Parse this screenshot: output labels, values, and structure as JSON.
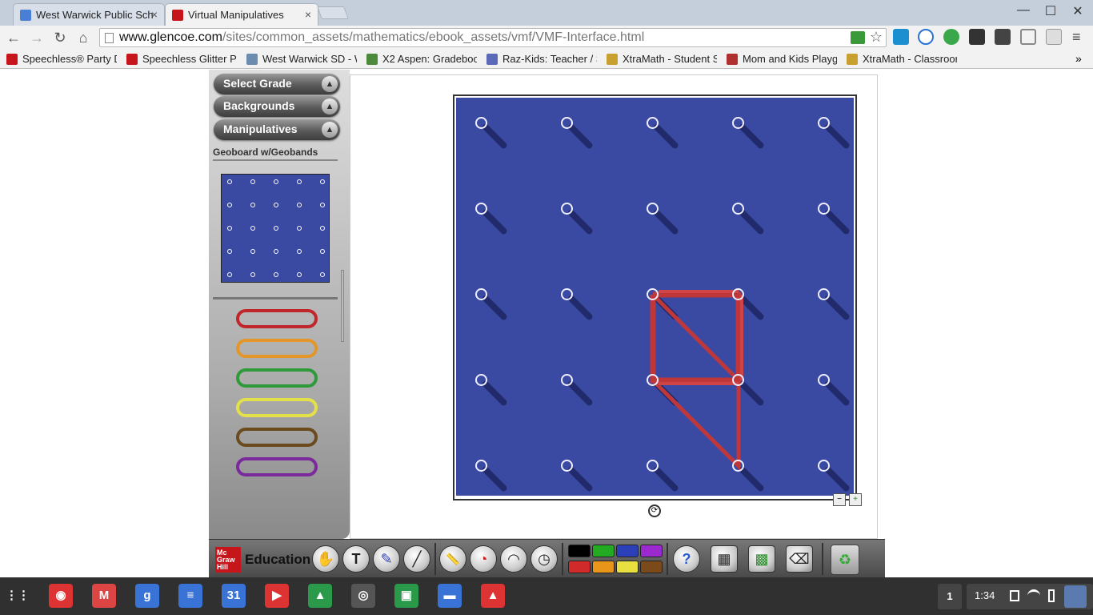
{
  "browser": {
    "tabs": [
      {
        "title": "West Warwick Public Sch",
        "close": "×",
        "favicon_color": "#4a7fd6"
      },
      {
        "title": "Virtual Manipulatives",
        "close": "×",
        "favicon_color": "#c6161c"
      }
    ],
    "window_controls": {
      "minimize": "—",
      "maximize": "☐",
      "close": "✕"
    },
    "nav": {
      "back": "←",
      "forward": "→",
      "reload": "↻",
      "home": "⌂"
    },
    "url": {
      "host": "www.glencoe.com",
      "path": "/sites/common_assets/mathematics/ebook_assets/vmf/VMF-Interface.html"
    },
    "star": "☆",
    "menu": "≡",
    "bookmarks": [
      {
        "label": "Speechless® Party D",
        "color": "#c6161c"
      },
      {
        "label": "Speechless Glitter Pr",
        "color": "#c6161c"
      },
      {
        "label": "West Warwick SD - W",
        "color": "#6a8caf"
      },
      {
        "label": "X2 Aspen: Gradeboo",
        "color": "#4a8a3a"
      },
      {
        "label": "Raz-Kids: Teacher / S",
        "color": "#5a6ab8"
      },
      {
        "label": "XtraMath - Student S",
        "color": "#c8a030"
      },
      {
        "label": "Mom and Kids Playgr",
        "color": "#b03030"
      },
      {
        "label": "XtraMath - Classroon",
        "color": "#c8a030"
      }
    ],
    "bookmarks_more": "»"
  },
  "app": {
    "menu": [
      {
        "label": "Select Grade",
        "arrow": "▲"
      },
      {
        "label": "Backgrounds",
        "arrow": "▲"
      },
      {
        "label": "Manipulatives",
        "arrow": "▲"
      }
    ],
    "panel_title": "Geoboard w/Geobands",
    "bands": [
      {
        "name": "red",
        "color": "#c0272d"
      },
      {
        "name": "orange",
        "color": "#e3962a"
      },
      {
        "name": "green",
        "color": "#2f9a3a"
      },
      {
        "name": "yellow",
        "color": "#e3e04a"
      },
      {
        "name": "brown",
        "color": "#6b4a1e"
      },
      {
        "name": "purple",
        "color": "#7a2a9a"
      }
    ],
    "board": {
      "grid": "5x5",
      "background": "#3a4aa3",
      "band_color": "#c0373a"
    },
    "zoom_out": "−",
    "zoom_in": "+",
    "rotate": "⟳",
    "brand": {
      "logo": "Mc Graw Hill",
      "text": "Education"
    },
    "tools": [
      {
        "name": "hand",
        "glyph": "✋"
      },
      {
        "name": "text",
        "glyph": "T"
      },
      {
        "name": "pen",
        "glyph": "✎"
      },
      {
        "name": "line",
        "glyph": "╱"
      },
      {
        "name": "ruler",
        "glyph": "📏"
      },
      {
        "name": "timer",
        "glyph": "◔"
      },
      {
        "name": "protractor",
        "glyph": "◠"
      },
      {
        "name": "clock",
        "glyph": "◷"
      }
    ],
    "colors": [
      "#000000",
      "#22aa22",
      "#2a3fb8",
      "#9a2ad0",
      "#d02a2a",
      "#e8951a",
      "#e8e040",
      "#7a4a1a"
    ],
    "actions": [
      {
        "name": "help",
        "glyph": "?"
      },
      {
        "name": "clear-page",
        "glyph": "▦"
      },
      {
        "name": "clear-all",
        "glyph": "▩"
      },
      {
        "name": "eraser",
        "glyph": "⌫"
      }
    ],
    "trash": "♻"
  },
  "shelf": {
    "apps": [
      {
        "name": "launcher",
        "glyph": "⋮⋮",
        "color": "#303030"
      },
      {
        "name": "chrome",
        "glyph": "◉",
        "color": "#d33"
      },
      {
        "name": "gmail",
        "glyph": "M",
        "color": "#d44"
      },
      {
        "name": "google-search",
        "glyph": "g",
        "color": "#3a73d6"
      },
      {
        "name": "docs",
        "glyph": "≡",
        "color": "#3a73d6"
      },
      {
        "name": "calendar",
        "glyph": "31",
        "color": "#3a73d6"
      },
      {
        "name": "youtube",
        "glyph": "▶",
        "color": "#d33"
      },
      {
        "name": "drive",
        "glyph": "▲",
        "color": "#2a9a4a"
      },
      {
        "name": "camera",
        "glyph": "◎",
        "color": "#555"
      },
      {
        "name": "classroom",
        "glyph": "▣",
        "color": "#2a9a4a"
      },
      {
        "name": "files",
        "glyph": "▬",
        "color": "#3a73d6"
      },
      {
        "name": "photos",
        "glyph": "▲",
        "color": "#d33"
      }
    ],
    "notification_count": "1",
    "time": "1:34"
  }
}
